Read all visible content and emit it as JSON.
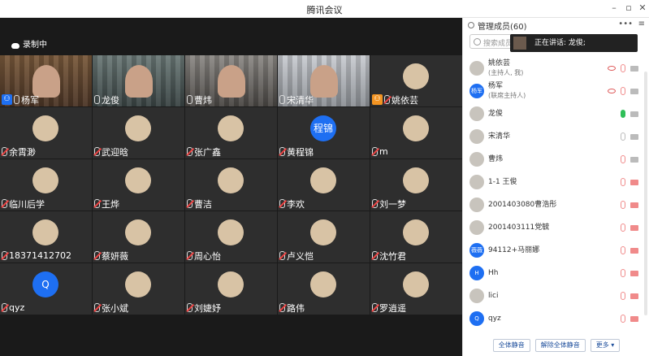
{
  "window": {
    "title": "腾讯会议"
  },
  "recording": {
    "label": "录制中"
  },
  "participants_panel": {
    "title": "管理成员(60)",
    "search_placeholder": "搜索成员",
    "speaking_label": "正在讲话: 龙俊;",
    "members": [
      {
        "name": "姚依芸",
        "sub": "(主持人, 我)",
        "av": ""
      },
      {
        "name": "杨军",
        "sub": "(联席主持人)",
        "av": "杨军"
      },
      {
        "name": "龙俊",
        "sub": "",
        "av": ""
      },
      {
        "name": "宋清华",
        "sub": "",
        "av": ""
      },
      {
        "name": "曹炜",
        "sub": "",
        "av": ""
      },
      {
        "name": "1-1 王俊",
        "sub": "",
        "av": ""
      },
      {
        "name": "2001403080曹浩彤",
        "sub": "",
        "av": ""
      },
      {
        "name": "2001403111党毓",
        "sub": "",
        "av": ""
      },
      {
        "name": "94112+马丽娜",
        "sub": "",
        "av": "薇薇"
      },
      {
        "name": "Hh",
        "sub": "",
        "av": "H"
      },
      {
        "name": "lici",
        "sub": "",
        "av": ""
      },
      {
        "name": "qyz",
        "sub": "",
        "av": "Q"
      }
    ],
    "buttons": {
      "mute_all": "全体静音",
      "unmute_all": "解除全体静音",
      "more": "更多 ▾"
    }
  },
  "tiles": [
    {
      "name": "杨军",
      "kind": "video"
    },
    {
      "name": "龙俊",
      "kind": "video"
    },
    {
      "name": "曹炜",
      "kind": "video"
    },
    {
      "name": "宋清华",
      "kind": "video"
    },
    {
      "name": "姚依芸",
      "kind": "avatar"
    },
    {
      "name": "余霄渺",
      "kind": "avatar"
    },
    {
      "name": "武迎晗",
      "kind": "avatar"
    },
    {
      "name": "张广鑫",
      "kind": "avatar"
    },
    {
      "name": "黄程锦",
      "kind": "avatar",
      "initial": "程锦"
    },
    {
      "name": "m",
      "kind": "avatar"
    },
    {
      "name": "临川后学",
      "kind": "avatar"
    },
    {
      "name": "王烨",
      "kind": "avatar"
    },
    {
      "name": "曹洁",
      "kind": "avatar"
    },
    {
      "name": "李欢",
      "kind": "avatar"
    },
    {
      "name": "刘一梦",
      "kind": "avatar"
    },
    {
      "name": "18371412702",
      "kind": "avatar"
    },
    {
      "name": "蔡妍薇",
      "kind": "avatar"
    },
    {
      "name": "周心怡",
      "kind": "avatar"
    },
    {
      "name": "卢义恺",
      "kind": "avatar"
    },
    {
      "name": "沈竹君",
      "kind": "avatar"
    },
    {
      "name": "qyz",
      "kind": "avatar",
      "initial": "Q"
    },
    {
      "name": "张小斌",
      "kind": "avatar"
    },
    {
      "name": "刘婕妤",
      "kind": "avatar"
    },
    {
      "name": "路伟",
      "kind": "avatar"
    },
    {
      "name": "罗逍遥",
      "kind": "avatar"
    }
  ]
}
